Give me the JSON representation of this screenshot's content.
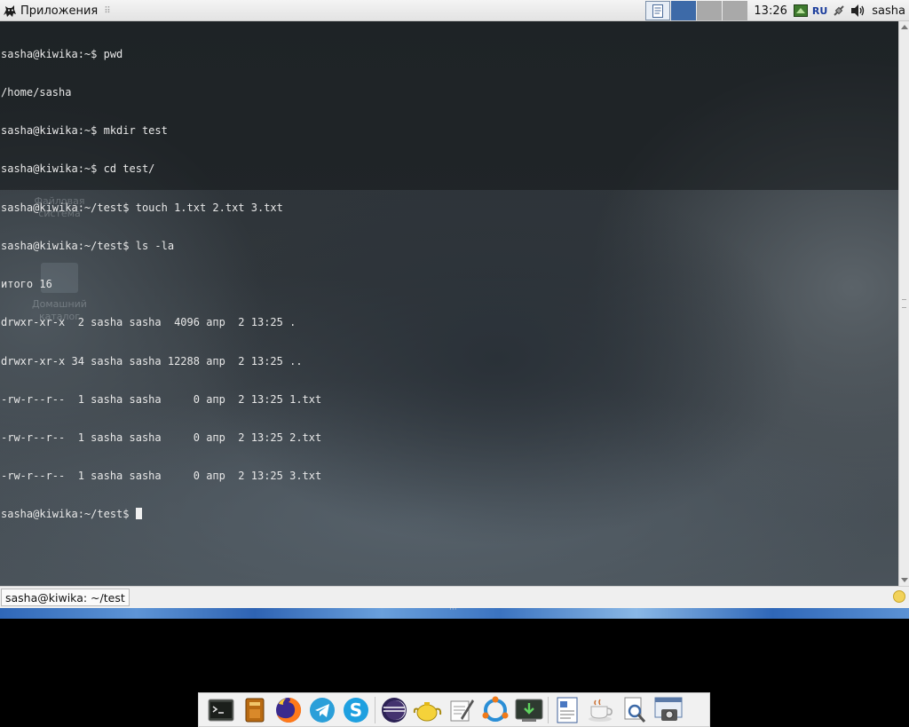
{
  "top_panel": {
    "apps_menu_label": "Приложения",
    "clock": "13:26",
    "keyboard_layout": "RU",
    "user_name": "sasha"
  },
  "terminal": {
    "lines": [
      "sasha@kiwika:~$ pwd",
      "/home/sasha",
      "sasha@kiwika:~$ mkdir test",
      "sasha@kiwika:~$ cd test/",
      "sasha@kiwika:~/test$ touch 1.txt 2.txt 3.txt",
      "sasha@kiwika:~/test$ ls -la",
      "итого 16",
      "drwxr-xr-x  2 sasha sasha  4096 апр  2 13:25 .",
      "drwxr-xr-x 34 sasha sasha 12288 апр  2 13:25 ..",
      "-rw-r--r--  1 sasha sasha     0 апр  2 13:25 1.txt",
      "-rw-r--r--  1 sasha sasha     0 апр  2 13:25 2.txt",
      "-rw-r--r--  1 sasha sasha     0 апр  2 13:25 3.txt"
    ],
    "prompt": "sasha@kiwika:~/test$ "
  },
  "desktop_icons": [
    {
      "label_line1": "Файловая",
      "label_line2": "система"
    },
    {
      "label_line1": "Домашний",
      "label_line2": "каталог"
    }
  ],
  "taskbar": {
    "active_window_label": "sasha@kiwika: ~/test"
  },
  "dock": {
    "items": [
      "terminal-icon",
      "library-icon",
      "firefox-icon",
      "telegram-icon",
      "skype-icon",
      "eclipse-icon",
      "teapot-icon",
      "text-editor-icon",
      "network-icon",
      "download-icon",
      "document-viewer-icon",
      "coffee-icon",
      "search-file-icon",
      "screenshot-icon"
    ]
  }
}
